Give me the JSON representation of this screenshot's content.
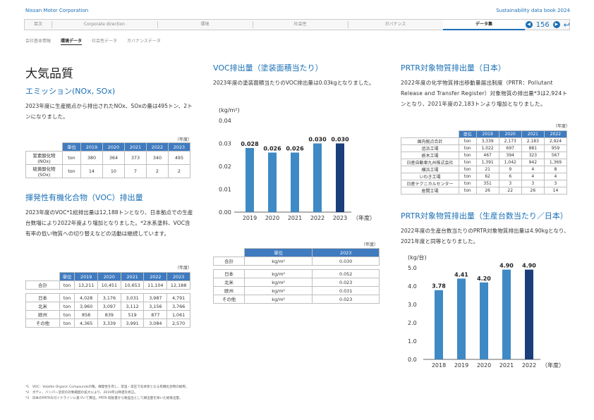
{
  "header": {
    "brand": "Nissan Motor Corporation",
    "book": "Sustainability data book 2024",
    "nav": [
      "目次",
      "Corporate direction",
      "環境",
      "社会性",
      "ガバナンス",
      "データ集"
    ],
    "page": "156",
    "subnav": [
      "会社基本情報",
      "環境データ",
      "社会性データ",
      "ガバナンスデータ"
    ]
  },
  "title": "大気品質",
  "emission": {
    "heading": "エミッション(NOx, SOx)",
    "text": "2023年度に生産拠点から排出されたNOx、SOxの量は495トン、2トンになりました。",
    "unit": "（年度）",
    "header": [
      "",
      "単位",
      "2019",
      "2020",
      "2021",
      "2022",
      "2023"
    ],
    "rows": [
      [
        "窒素酸化物(NOx)",
        "ton",
        "380",
        "364",
        "373",
        "340",
        "495"
      ],
      [
        "硫黄酸化物(SOx)",
        "ton",
        "14",
        "10",
        "7",
        "2",
        "2"
      ]
    ]
  },
  "voc": {
    "heading": "揮発性有機化合物（VOC）排出量",
    "text": "2023年度のVOC*1総排出量は12,188トンとなり、日本拠点での生産台数増により2022年度より増加となりました。*2水系塗料、VOC含有率の低い物質への切り替えなどの活動は継続しています。",
    "unit": "（年度）",
    "header": [
      "",
      "単位",
      "2019",
      "2020",
      "2021",
      "2022",
      "2023"
    ],
    "total": [
      "合計",
      "ton",
      "13,211",
      "10,451",
      "10,653",
      "11,104",
      "12,188"
    ],
    "rows": [
      [
        "日本",
        "ton",
        "4,028",
        "3,176",
        "3,031",
        "3,987",
        "4,791"
      ],
      [
        "北米",
        "ton",
        "3,960",
        "3,097",
        "3,112",
        "3,156",
        "3,766"
      ],
      [
        "欧州",
        "ton",
        "858",
        "839",
        "519",
        "877",
        "1,061"
      ],
      [
        "その他",
        "ton",
        "4,365",
        "3,339",
        "3,991",
        "3,084",
        "2,570"
      ]
    ]
  },
  "voc_area": {
    "heading": "VOC排出量（塗装面積当たり）",
    "text": "2023年度の塗装面積当たりのVOC排出量は0.03kgとなりました。",
    "unit": "（年度）",
    "header": [
      "",
      "単位",
      "2023"
    ],
    "total": [
      "合計",
      "kg/m²",
      "0.030"
    ],
    "rows": [
      [
        "日本",
        "kg/m²",
        "0.052"
      ],
      [
        "北米",
        "kg/m²",
        "0.023"
      ],
      [
        "欧州",
        "kg/m²",
        "0.031"
      ],
      [
        "その他",
        "kg/m²",
        "0.023"
      ]
    ]
  },
  "prtr": {
    "heading": "PRTR対象物質排出量（日本）",
    "text": "2022年度の化学物質排出移動量届出制度（PRTR：Pollutant Release and Transfer Register）対象物質の排出量*3は2,924トンとなり、2021年度の2,183トンより増加となりました。",
    "unit": "（年度）",
    "header": [
      "",
      "単位",
      "2019",
      "2020",
      "2021",
      "2022"
    ],
    "rows": [
      [
        "国内拠点合計",
        "ton",
        "3,339",
        "2,173",
        "2,183",
        "2,924"
      ],
      [
        "追浜工場",
        "ton",
        "1,022",
        "697",
        "881",
        "959"
      ],
      [
        "栃木工場",
        "ton",
        "467",
        "394",
        "323",
        "567"
      ],
      [
        "日産自動車九州株式会社",
        "ton",
        "1,391",
        "1,042",
        "942",
        "1,369"
      ],
      [
        "横浜工場",
        "ton",
        "21",
        "9",
        "4",
        "8"
      ],
      [
        "いわき工場",
        "ton",
        "62",
        "6",
        "4",
        "4"
      ],
      [
        "日産テクニカルセンター",
        "ton",
        "351",
        "3",
        "3",
        "3"
      ],
      [
        "座間工場",
        "ton",
        "26",
        "22",
        "26",
        "14"
      ]
    ]
  },
  "prtr_unit": {
    "heading": "PRTR対象物質排出量（生産台数当たり／日本）",
    "text": "2022年度の生産台数当たりのPRTR対象物質排出量は4.90kgとなり、2021年度と同等となりました。"
  },
  "chart_data": [
    {
      "type": "bar",
      "ylabel": "(kg/m²)",
      "xlabel": "（年度）",
      "categories": [
        "2019",
        "2020",
        "2021",
        "2022",
        "2023"
      ],
      "values": [
        0.028,
        0.026,
        0.026,
        0.03,
        0.03
      ],
      "labels": [
        "0.028",
        "0.026",
        "0.026",
        "0.030",
        "0.030"
      ],
      "ylim": [
        0,
        0.04
      ],
      "ticks": [
        "0.00",
        "0.01",
        "0.02",
        "0.03",
        "0.04"
      ],
      "colors": [
        "#3f8ac4",
        "#3f8ac4",
        "#3f8ac4",
        "#3f8ac4",
        "#1a3f7a"
      ]
    },
    {
      "type": "bar",
      "ylabel": "(kg/台)",
      "xlabel": "（年度）",
      "categories": [
        "2018",
        "2019",
        "2020",
        "2021",
        "2022"
      ],
      "values": [
        3.78,
        4.41,
        4.2,
        4.9,
        4.9
      ],
      "labels": [
        "3.78",
        "4.41",
        "4.20",
        "4.90",
        "4.90"
      ],
      "ylim": [
        0,
        5.0
      ],
      "ticks": [
        "0.0",
        "1.0",
        "2.0",
        "3.0",
        "4.0",
        "5.0"
      ],
      "colors": [
        "#3f8ac4",
        "#3f8ac4",
        "#3f8ac4",
        "#3f8ac4",
        "#1a3f7a"
      ]
    }
  ],
  "footnotes": [
    "*1　VOC：Volatile Organic Compoundsの略。揮発性を有し、常温・常圧で気体状となる有機化合物の総称。",
    "*2　ボディ、バンパー塗装の対象範囲の拡大により、2019年以降値を修正。",
    "*3　日本のPRTRのガイドラインに基づいて算出。PRTR 取扱量から製品出として繰出量を除いた総排出量。"
  ]
}
